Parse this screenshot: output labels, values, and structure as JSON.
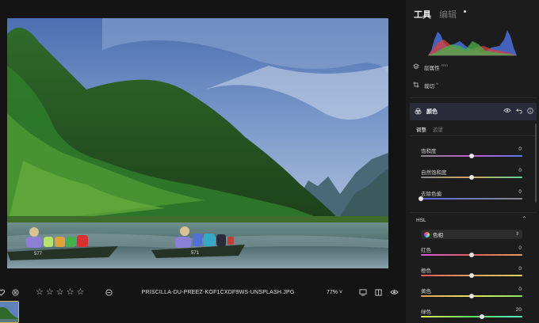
{
  "file": {
    "name": "PRISCILLA-DU-PREEZ-KOF1CXDF9WS-UNSPLASH.JPG",
    "zoom": "77%",
    "zoom_caret": "˅"
  },
  "panel": {
    "tab_tools": "工具",
    "tab_edit": "编辑",
    "layer_properties": "层属性",
    "layer_properties_badge": "PRO",
    "crop": "裁切",
    "crop_badge": "N",
    "color_section": "颜色",
    "subtab_adjust": "调整",
    "subtab_mask": "遮罩",
    "sliders": [
      {
        "label": "饱和度",
        "value": "0",
        "level": 0.5
      },
      {
        "label": "自然饱和度",
        "value": "0",
        "level": 0.5
      },
      {
        "label": "去除色偏",
        "value": "0",
        "level": 0.0
      }
    ],
    "hsl_title": "HSL",
    "hsl_select": "色相",
    "hsl_sliders": [
      {
        "label": "红色",
        "value": "0",
        "level": 0.5
      },
      {
        "label": "橙色",
        "value": "0",
        "level": 0.5
      },
      {
        "label": "黄色",
        "value": "0",
        "level": 0.5
      },
      {
        "label": "绿色",
        "value": "20",
        "level": 0.6
      }
    ]
  },
  "rating": {
    "stars": 5,
    "filled": 0
  },
  "icons": {
    "heart": "heart-icon",
    "reject": "reject-icon",
    "star": "star-icon",
    "minus": "minus-circle-icon",
    "compare": "compare-icon",
    "split": "split-view-icon",
    "eye": "eye-icon",
    "layers": "layers-icon",
    "crop": "crop-icon",
    "color": "color-icon",
    "undo": "undo-icon",
    "info": "info-icon"
  },
  "colors": {
    "panel_bg": "#1c1c1c",
    "section_highlight": "#2a2b3a",
    "thumb_border": "#d8b24a"
  }
}
